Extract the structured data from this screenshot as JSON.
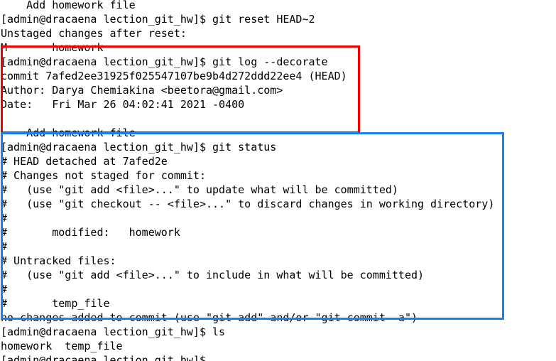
{
  "terminal": {
    "lines": [
      "    Add homework file",
      "[admin@dracaena lection_git_hw]$ git reset HEAD~2",
      "Unstaged changes after reset:",
      "M       homework",
      "[admin@dracaena lection_git_hw]$ git log --decorate",
      "commit 7afed2ee31925f025547107be9b4d272ddd22ee4 (HEAD)",
      "Author: Darya Chemiakina <beetora@gmail.com>",
      "Date:   Fri Mar 26 04:02:41 2021 -0400",
      "",
      "    Add homework file",
      "[admin@dracaena lection_git_hw]$ git status",
      "# HEAD detached at 7afed2e",
      "# Changes not staged for commit:",
      "#   (use \"git add <file>...\" to update what will be committed)",
      "#   (use \"git checkout -- <file>...\" to discard changes in working directory)",
      "#",
      "#       modified:   homework",
      "#",
      "# Untracked files:",
      "#   (use \"git add <file>...\" to include in what will be committed)",
      "#",
      "#       temp_file",
      "no changes added to commit (use \"git add\" and/or \"git commit -a\")",
      "[admin@dracaena lection_git_hw]$ ls",
      "homework  temp_file",
      "[admin@dracaena lection_git_hw]$"
    ]
  },
  "highlights": {
    "log_box_color": "#ee0000",
    "status_box_color": "#1a7ff0"
  }
}
